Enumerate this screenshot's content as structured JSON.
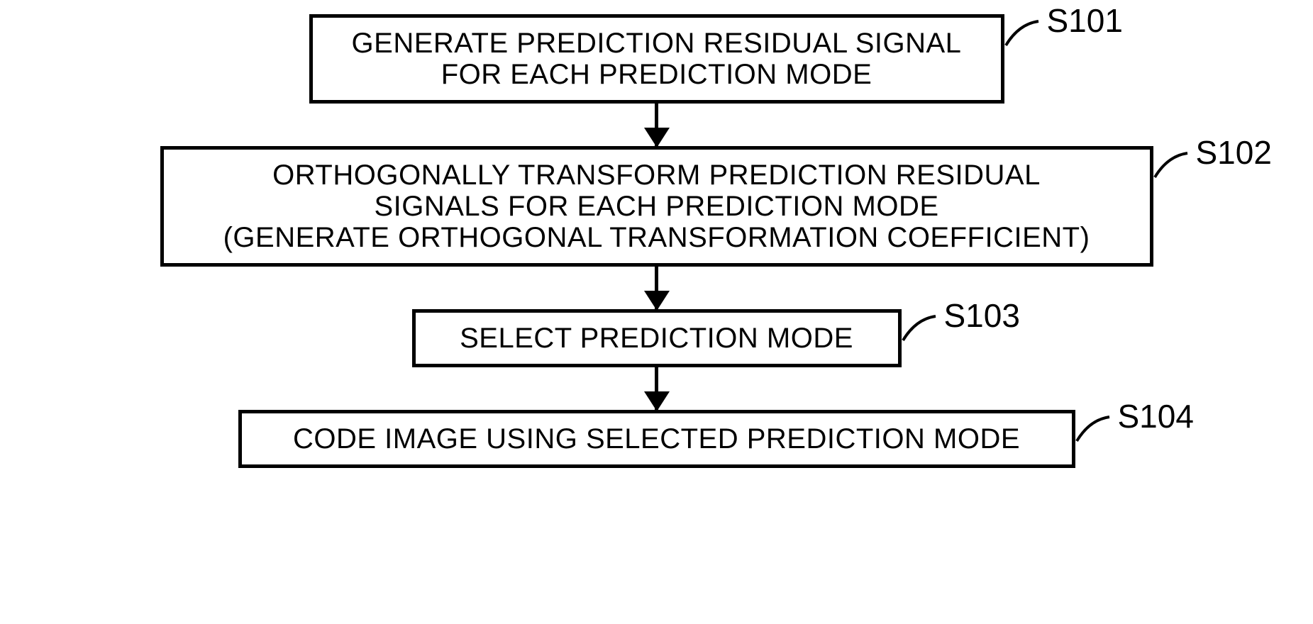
{
  "steps": [
    {
      "label": "S101",
      "text": "GENERATE PREDICTION RESIDUAL SIGNAL\nFOR EACH PREDICTION MODE"
    },
    {
      "label": "S102",
      "text": "ORTHOGONALLY TRANSFORM PREDICTION RESIDUAL\nSIGNALS FOR EACH PREDICTION MODE\n(GENERATE ORTHOGONAL TRANSFORMATION COEFFICIENT)"
    },
    {
      "label": "S103",
      "text": "SELECT PREDICTION MODE"
    },
    {
      "label": "S104",
      "text": "CODE IMAGE USING SELECTED PREDICTION MODE"
    }
  ]
}
